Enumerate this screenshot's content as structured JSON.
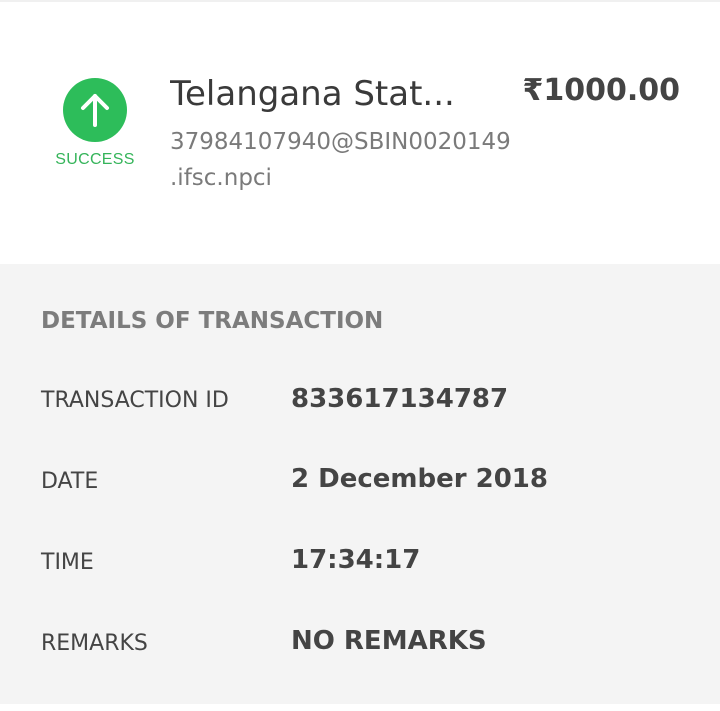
{
  "header": {
    "status": "SUCCESS",
    "status_icon": "arrow-up-icon",
    "status_color": "#2dbd5a",
    "payee_name": "Telangana Stat...",
    "payee_upi": "37984107940@SBIN0020149 .ifsc.npci",
    "amount": "₹1000.00"
  },
  "details": {
    "title": "DETAILS OF TRANSACTION",
    "rows": [
      {
        "label": "TRANSACTION ID",
        "value": "833617134787"
      },
      {
        "label": "DATE",
        "value": "2 December 2018"
      },
      {
        "label": "TIME",
        "value": "17:34:17"
      },
      {
        "label": "REMARKS",
        "value": "NO REMARKS"
      }
    ]
  }
}
